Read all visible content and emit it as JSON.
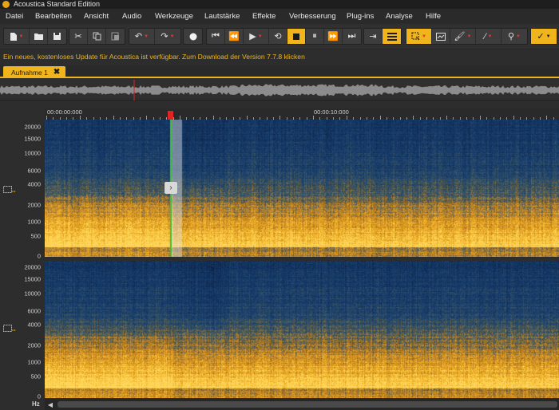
{
  "window": {
    "title": "Acoustica Standard Edition"
  },
  "menu": {
    "items": [
      "Datei",
      "Bearbeiten",
      "Ansicht",
      "Audio",
      "Werkzeuge",
      "Lautstärke",
      "Effekte",
      "Verbesserung",
      "Plug-ins",
      "Analyse",
      "Hilfe"
    ]
  },
  "toolbar": {
    "icons": [
      "new-file-icon",
      "open-folder-icon",
      "save-icon",
      "cut-icon",
      "copy-icon",
      "paste-icon",
      "undo-icon",
      "redo-icon",
      "record-icon",
      "skip-start-icon",
      "rewind-icon",
      "play-icon",
      "loop-icon",
      "stop-icon",
      "pause-icon",
      "fast-forward-icon",
      "skip-end-icon",
      "scrub-icon",
      "spectrogram-view-icon",
      "selection-tool-icon",
      "view-tool-icon",
      "brush-tool-icon",
      "magic-wand-icon",
      "zoom-tool-icon",
      "settings-tool-icon"
    ]
  },
  "notification": {
    "text": "Ein neues, kostenloses Update für Acoustica ist verfügbar. Zum Download der Version 7.7.8 klicken"
  },
  "tabs": [
    {
      "label": "Aufnahme 1",
      "close": "✖"
    }
  ],
  "timeline": {
    "labels": [
      "00:00:00:000",
      "00:00:10:000"
    ]
  },
  "frequency_axis": {
    "unit": "Hz",
    "labels": [
      "20000",
      "15000",
      "10000",
      "6000",
      "4000",
      "2000",
      "1000",
      "500",
      "0"
    ]
  },
  "colors": {
    "accent": "#f0b41c",
    "spectrogram_low": "#163a6b",
    "spectrogram_high": "#f6b625",
    "playhead": "#e02424",
    "cursor": "#3fbf3f"
  }
}
